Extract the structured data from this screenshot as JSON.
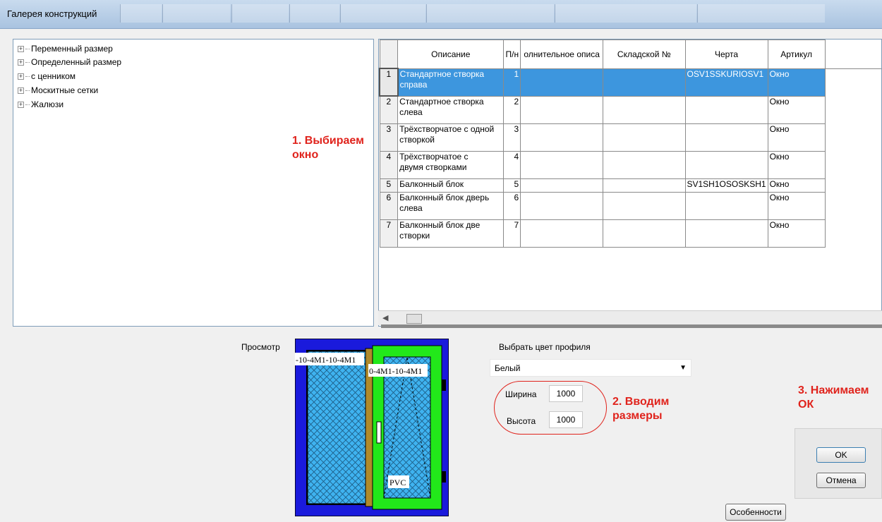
{
  "window": {
    "title": "Галерея конструкций"
  },
  "tree": {
    "items": [
      {
        "label": "Переменный размер"
      },
      {
        "label": "Определенный размер"
      },
      {
        "label": "с ценником"
      },
      {
        "label": "Москитные сетки"
      },
      {
        "label": "Жалюзи"
      }
    ]
  },
  "annotations": {
    "step1_line1": "1. Выбираем",
    "step1_line2": "окно",
    "step2_line1": "2. Вводим",
    "step2_line2": "размеры",
    "step3_line1": "3. Нажимаем",
    "step3_line2": "ОК"
  },
  "grid": {
    "columns": [
      "Описание",
      "П/н",
      "олнительное описа",
      "Складской №",
      "Черта",
      "Артикул"
    ],
    "rows": [
      {
        "n": "1",
        "desc": [
          "Стандартное створка",
          "справа"
        ],
        "pn": "1",
        "extra": "",
        "stock": "",
        "line": "OSV1SSKURIOSV1",
        "art": "Окно",
        "selected": true
      },
      {
        "n": "2",
        "desc": [
          "Стандартное створка",
          "слева"
        ],
        "pn": "2",
        "extra": "",
        "stock": "",
        "line": "",
        "art": "Окно"
      },
      {
        "n": "3",
        "desc": [
          "Трёхстворчатое с одной",
          "створкой"
        ],
        "pn": "3",
        "extra": "",
        "stock": "",
        "line": "",
        "art": "Окно"
      },
      {
        "n": "4",
        "desc": [
          "Трёхстворчатое с",
          "двумя створками"
        ],
        "pn": "4",
        "extra": "",
        "stock": "",
        "line": "",
        "art": "Окно"
      },
      {
        "n": "5",
        "desc": [
          "Балконный блок"
        ],
        "pn": "5",
        "extra": "",
        "stock": "",
        "line": "SV1SH1OSOSKSH1",
        "art": "Окно"
      },
      {
        "n": "6",
        "desc": [
          "Балконный блок дверь",
          "слева"
        ],
        "pn": "6",
        "extra": "",
        "stock": "",
        "line": "",
        "art": "Окно"
      },
      {
        "n": "7",
        "desc": [
          "Балконный блок две",
          "створки"
        ],
        "pn": "7",
        "extra": "",
        "stock": "",
        "line": "",
        "art": "Окно"
      }
    ]
  },
  "preview": {
    "label": "Просмотр",
    "glass_left": "-10-4M1-10-4M1",
    "glass_right": "0-4M1-10-4M1",
    "material": "PVC",
    "colors": {
      "frame": "#1a1adc",
      "sash": "#22e81a",
      "glass": "#3fb3f0"
    }
  },
  "profile": {
    "label": "Выбрать цвет профиля",
    "value": "Белый"
  },
  "size": {
    "width_label": "Ширина",
    "width_value": "1000",
    "height_label": "Высота",
    "height_value": "1000"
  },
  "buttons": {
    "ok": "OK",
    "cancel": "Отмена",
    "features": "Особенности"
  }
}
